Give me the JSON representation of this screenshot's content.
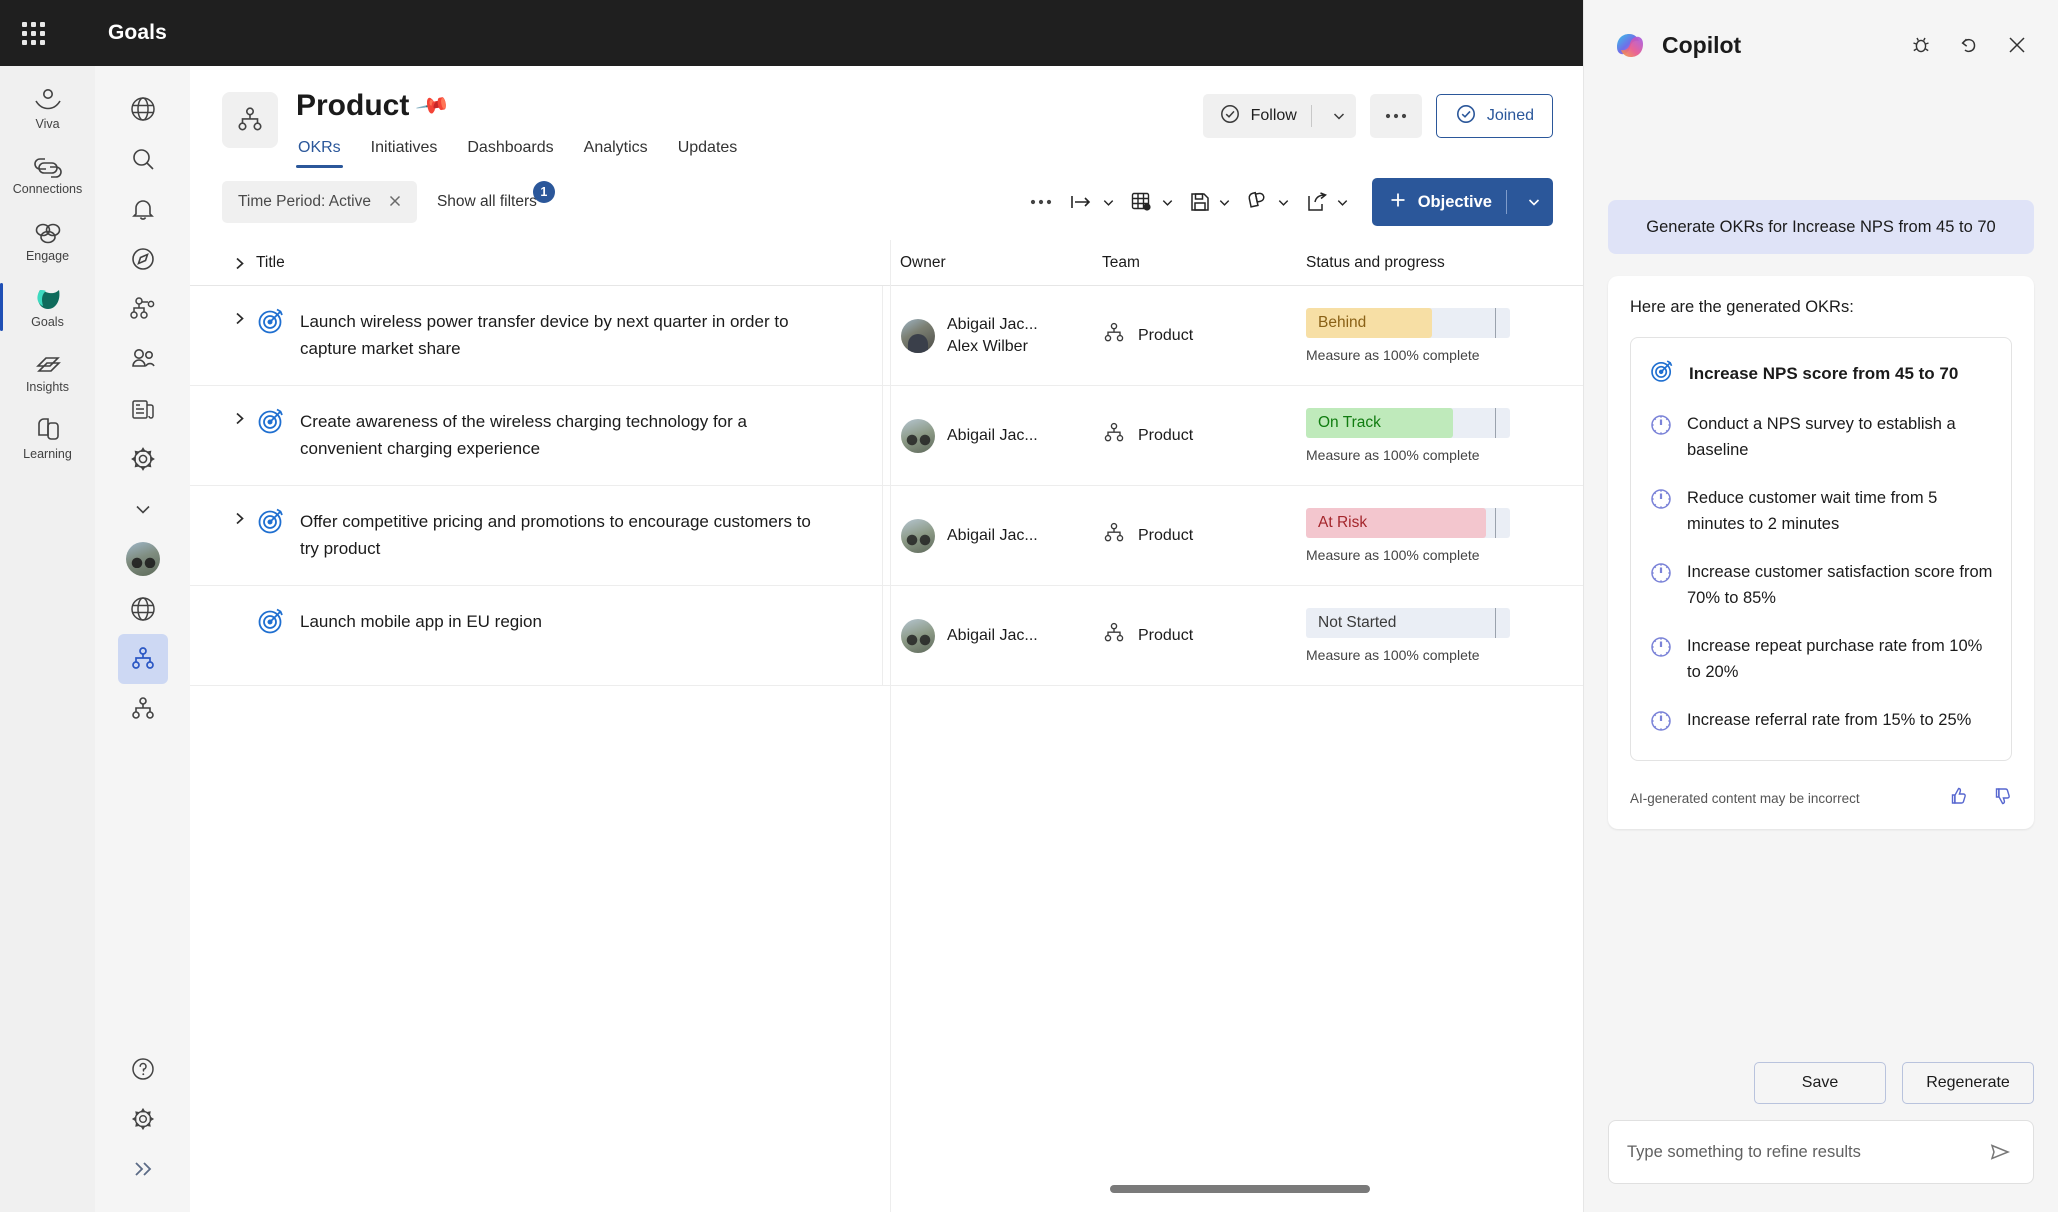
{
  "topbar": {
    "app_title": "Goals",
    "waffle_icon": "app-launcher-icon"
  },
  "viva_rail": {
    "items": [
      {
        "label": "Viva",
        "icon": "viva-person-icon",
        "selected": false
      },
      {
        "label": "Connections",
        "icon": "connections-link-icon",
        "selected": false
      },
      {
        "label": "Engage",
        "icon": "engage-clover-icon",
        "selected": false
      },
      {
        "label": "Goals",
        "icon": "goals-leaf-icon",
        "selected": true
      },
      {
        "label": "Insights",
        "icon": "insights-layers-icon",
        "selected": false
      },
      {
        "label": "Learning",
        "icon": "learning-pages-icon",
        "selected": false
      }
    ]
  },
  "nav_rail": {
    "items": [
      {
        "icon": "globe-icon",
        "selected": false
      },
      {
        "icon": "search-icon",
        "selected": false
      },
      {
        "icon": "bell-icon",
        "selected": false
      },
      {
        "icon": "compass-icon",
        "selected": false
      },
      {
        "icon": "org-chart-icon",
        "selected": false
      },
      {
        "icon": "people-icon",
        "selected": false
      },
      {
        "icon": "news-icon",
        "selected": false
      },
      {
        "icon": "gear-icon",
        "selected": false
      },
      {
        "icon": "chevron-down-icon",
        "selected": false
      },
      {
        "icon": "user-avatar-icon",
        "selected": false
      },
      {
        "icon": "globe-icon",
        "selected": false
      },
      {
        "icon": "org-chart-icon",
        "selected": true
      },
      {
        "icon": "org-chart-icon",
        "selected": false
      }
    ],
    "bottom_items": [
      {
        "icon": "help-circle-icon"
      },
      {
        "icon": "gear-icon"
      },
      {
        "icon": "expand-chevrons-icon"
      }
    ]
  },
  "page": {
    "team_icon": "org-chart-icon",
    "title": "Product",
    "pin_icon": "pin-icon",
    "tabs": [
      {
        "label": "OKRs",
        "selected": true
      },
      {
        "label": "Initiatives",
        "selected": false
      },
      {
        "label": "Dashboards",
        "selected": false
      },
      {
        "label": "Analytics",
        "selected": false
      },
      {
        "label": "Updates",
        "selected": false
      }
    ],
    "actions": {
      "follow_label": "Follow",
      "follow_icon": "check-circle-icon",
      "follow_caret_icon": "chevron-down-icon",
      "more_label": "•••",
      "joined_label": "Joined",
      "joined_icon": "check-circle-icon"
    }
  },
  "toolbar": {
    "filter_chip_label": "Time Period: Active",
    "filter_chip_close_icon": "close-icon",
    "show_all_filters_label": "Show all filters",
    "filter_count": "1",
    "more_icon": "ellipsis-icon",
    "buttons": [
      {
        "icon": "indent-arrow-icon",
        "caret": true
      },
      {
        "icon": "table-settings-icon",
        "caret": true
      },
      {
        "icon": "save-disk-icon",
        "caret": true
      },
      {
        "icon": "copy-pages-icon",
        "caret": true
      },
      {
        "icon": "share-export-icon",
        "caret": true
      }
    ],
    "objective_label": "Objective",
    "objective_plus_icon": "plus-icon",
    "objective_caret_icon": "chevron-down-icon"
  },
  "table": {
    "columns": [
      "Title",
      "Owner",
      "Team",
      "Status and progress"
    ],
    "measure_text": "Measure as 100% complete",
    "rows": [
      {
        "expandable": true,
        "goal_icon": "target-icon",
        "title": "Launch wireless power transfer device by next quarter in order to capture market share",
        "owners": [
          "Abigail Jac...",
          "Alex Wilber"
        ],
        "avatar": "person-avatar",
        "team": "Product",
        "team_icon": "org-chart-icon",
        "status": "Behind",
        "status_color": "#f7dfa5",
        "status_text_color": "#8a6116",
        "progress_pct": 62
      },
      {
        "expandable": true,
        "goal_icon": "target-icon",
        "title": "Create awareness of the wireless charging technology for a convenient charging experience",
        "owners": [
          "Abigail Jac..."
        ],
        "avatar": "bike-avatar",
        "team": "Product",
        "team_icon": "org-chart-icon",
        "status": "On Track",
        "status_color": "#bfeabb",
        "status_text_color": "#107c10",
        "progress_pct": 72
      },
      {
        "expandable": true,
        "goal_icon": "target-icon",
        "title": "Offer competitive pricing and promotions to encourage customers to try product",
        "owners": [
          "Abigail Jac..."
        ],
        "avatar": "bike-avatar",
        "team": "Product",
        "team_icon": "org-chart-icon",
        "status": "At Risk",
        "status_color": "#f3c6ce",
        "status_text_color": "#a4262c",
        "progress_pct": 88
      },
      {
        "expandable": false,
        "goal_icon": "target-icon",
        "title": "Launch mobile app in EU region",
        "owners": [
          "Abigail Jac..."
        ],
        "avatar": "bike-avatar",
        "team": "Product",
        "team_icon": "org-chart-icon",
        "status": "Not Started",
        "status_color": "#eaeef5",
        "status_text_color": "#3b3b3b",
        "progress_pct": 0
      }
    ]
  },
  "copilot": {
    "title": "Copilot",
    "logo_icon": "copilot-logo-icon",
    "header_icons": [
      {
        "icon": "bug-icon"
      },
      {
        "icon": "undo-arrow-icon"
      },
      {
        "icon": "close-icon"
      }
    ],
    "user_prompt": "Generate OKRs for Increase NPS from 45 to 70",
    "answer_lead": "Here are the generated OKRs:",
    "objective": {
      "icon": "target-icon",
      "text": "Increase NPS score from 45 to 70"
    },
    "key_results": [
      {
        "icon": "gauge-icon",
        "text": "Conduct a NPS survey to establish a baseline"
      },
      {
        "icon": "gauge-icon",
        "text": "Reduce customer wait time from 5 minutes to 2 minutes"
      },
      {
        "icon": "gauge-icon",
        "text": "Increase customer satisfaction score from 70% to 85%"
      },
      {
        "icon": "gauge-icon",
        "text": "Increase repeat purchase rate from 10% to 20%"
      },
      {
        "icon": "gauge-icon",
        "text": "Increase referral rate from 15% to 25%"
      }
    ],
    "disclaimer": "AI-generated content may be incorrect",
    "thumbs_up_icon": "thumbs-up-icon",
    "thumbs_down_icon": "thumbs-down-icon",
    "save_label": "Save",
    "regenerate_label": "Regenerate",
    "input_placeholder": "Type something to refine results",
    "send_icon": "send-icon"
  },
  "colors": {
    "accent": "#2b579a",
    "topbar_bg": "#1f1f1f",
    "rail_bg": "#f0f0f0",
    "panel_bg": "#f5f5f5",
    "user_bubble": "#dfe3f7"
  }
}
